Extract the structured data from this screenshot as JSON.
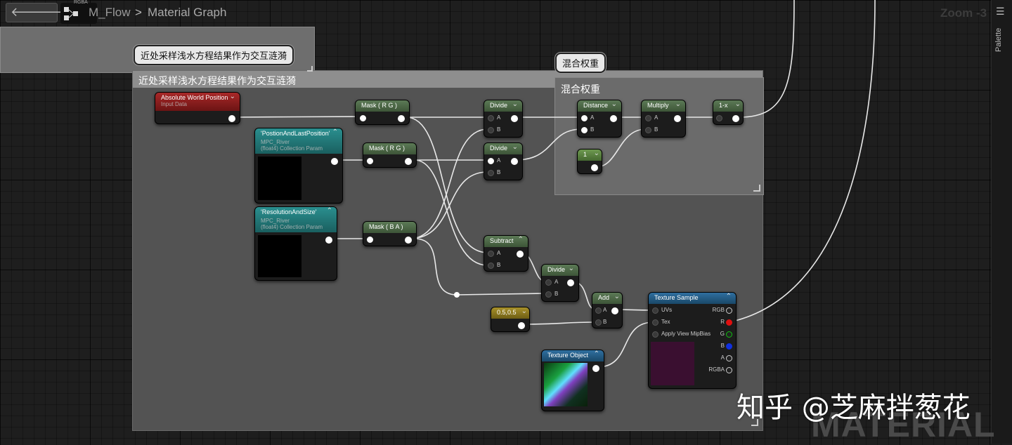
{
  "header": {
    "rgba_tag": "RGBA",
    "material_name": "M_Flow",
    "separator": ">",
    "graph_name": "Material Graph",
    "zoom": "Zoom -3"
  },
  "side_panel": {
    "palette_label": "Palette",
    "menu_icon": "hamburger-menu-icon"
  },
  "comments": {
    "top_bubble": "近处采样浅水方程结果作为交互涟漪",
    "big_header": "近处采样浅水方程结果作为交互涟漪",
    "blend_bubble": "混合权重",
    "blend_header": "混合权重"
  },
  "nodes": {
    "abs_world_pos": {
      "title": "Absolute World Position",
      "sub": "Input Data"
    },
    "mask_rg_1": {
      "title": "Mask ( R G )"
    },
    "mask_rg_2": {
      "title": "Mask ( R G )"
    },
    "mask_ba": {
      "title": "Mask ( B A )"
    },
    "pos_last": {
      "title": "'PostionAndLastPosition'",
      "sub1": "MPC_River",
      "sub2": "(float4) Collection Param"
    },
    "res_size": {
      "title": "'ResolutionAndSize'",
      "sub1": "MPC_River",
      "sub2": "(float4) Collection Param"
    },
    "divide_1": {
      "title": "Divide",
      "a": "A",
      "b": "B"
    },
    "divide_2": {
      "title": "Divide",
      "a": "A",
      "b": "B"
    },
    "divide_3": {
      "title": "Divide",
      "a": "A",
      "b": "B"
    },
    "subtract": {
      "title": "Subtract",
      "a": "A",
      "b": "B"
    },
    "add": {
      "title": "Add",
      "a": "A",
      "b": "B"
    },
    "distance": {
      "title": "Distance",
      "a": "A",
      "b": "B"
    },
    "multiply": {
      "title": "Multiply",
      "a": "A",
      "b": "B"
    },
    "one_minus": {
      "title": "1-x"
    },
    "const_one": {
      "title": "1"
    },
    "const_half": {
      "title": "0.5,0.5"
    },
    "texture_object": {
      "title": "Texture Object"
    },
    "texture_sample": {
      "title": "Texture Sample",
      "inputs": [
        "UVs",
        "Tex",
        "Apply View MipBias"
      ],
      "outputs": [
        "RGB",
        "R",
        "G",
        "B",
        "A",
        "RGBA"
      ]
    }
  },
  "colors": {
    "wire": "#ffffff",
    "pin_r": "#e01010",
    "pin_g": "#10c010",
    "pin_b": "#1030e0",
    "teal": "#2a8f8f",
    "green": "#5c7a56"
  },
  "watermark": {
    "zhihu": "知乎 @芝麻拌葱花",
    "material": "MATERIAL"
  }
}
